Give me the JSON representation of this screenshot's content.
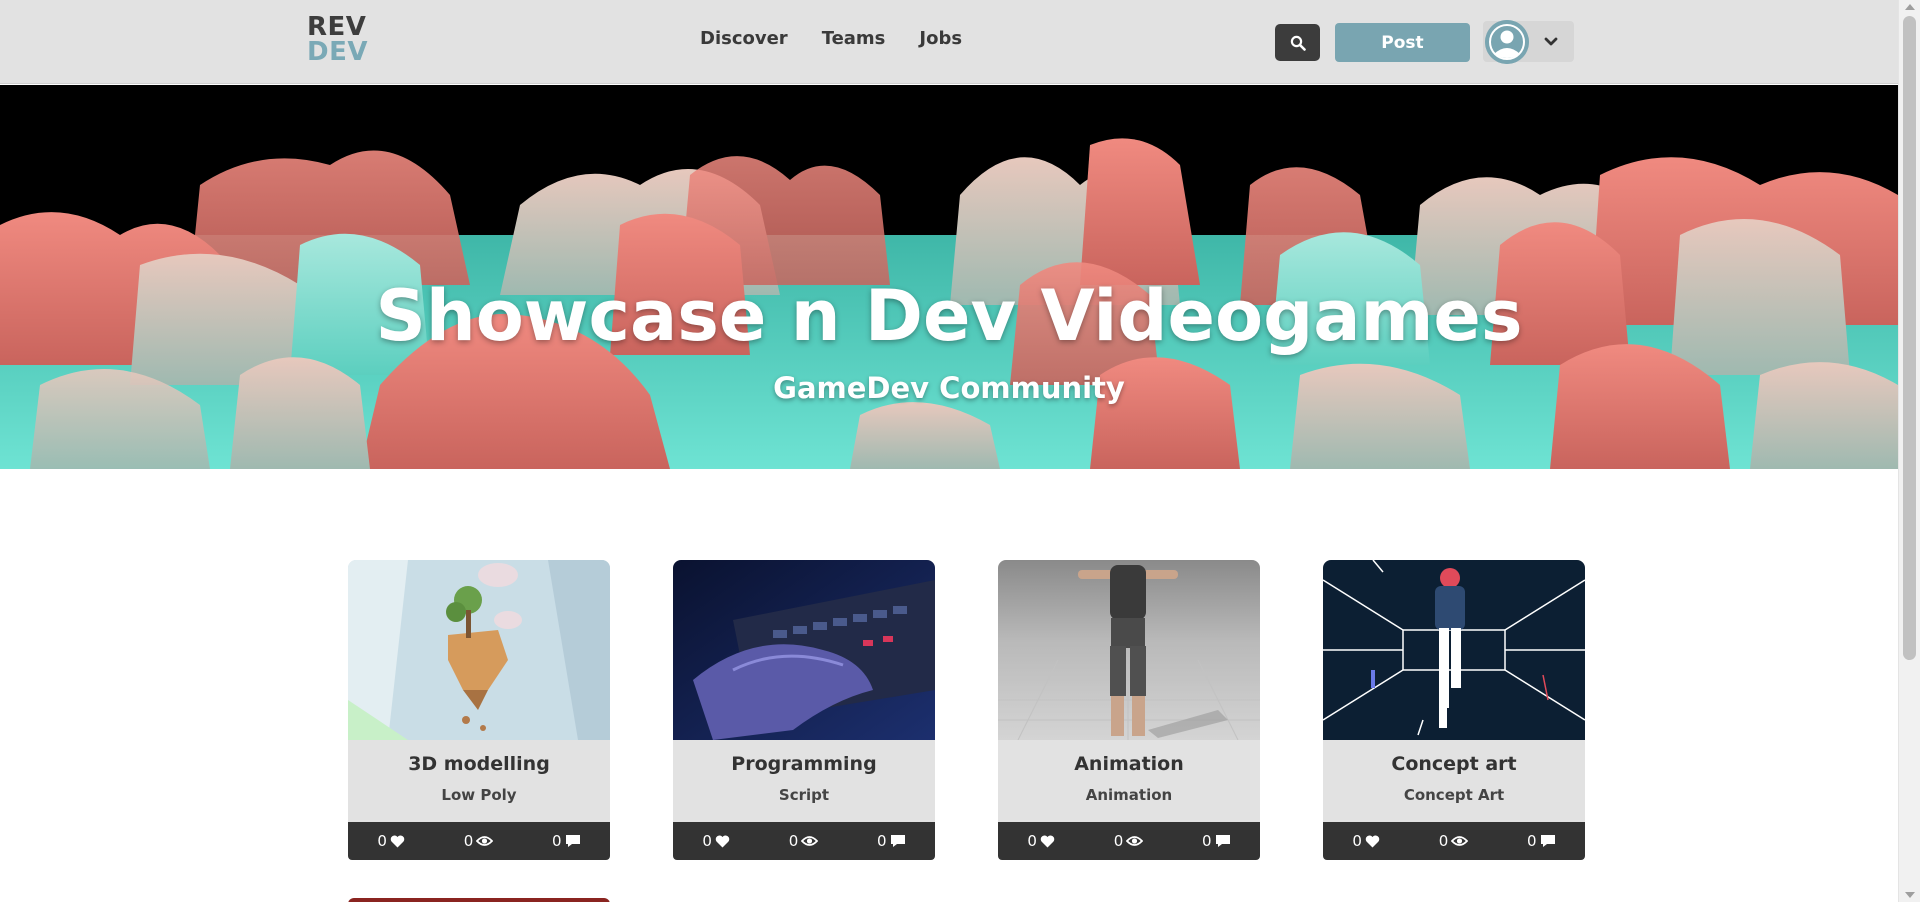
{
  "brand": {
    "line1": "REV",
    "line2": "DEV"
  },
  "nav": {
    "items": [
      "Discover",
      "Teams",
      "Jobs"
    ]
  },
  "header": {
    "post_label": "Post",
    "search_icon": "search-icon",
    "avatar_icon": "user-avatar-icon",
    "menu_icon": "chevron-down-icon"
  },
  "hero": {
    "title": "Showcase n Dev Videogames",
    "subtitle": "GameDev Community"
  },
  "colors": {
    "topbar": "#e2e2e2",
    "accent": "#79a5b1",
    "dark": "#333333",
    "coral": "#e8766e",
    "teal": "#5fd8c8"
  },
  "cards": [
    {
      "title": "3D modelling",
      "subtitle": "Low Poly",
      "likes": "0",
      "views": "0",
      "comments": "0"
    },
    {
      "title": "Programming",
      "subtitle": "Script",
      "likes": "0",
      "views": "0",
      "comments": "0"
    },
    {
      "title": "Animation",
      "subtitle": "Animation",
      "likes": "0",
      "views": "0",
      "comments": "0"
    },
    {
      "title": "Concept art",
      "subtitle": "Concept Art",
      "likes": "0",
      "views": "0",
      "comments": "0"
    }
  ]
}
